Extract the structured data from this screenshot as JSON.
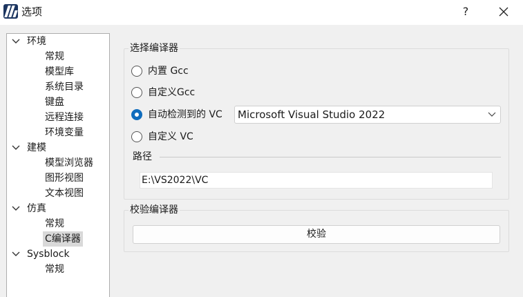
{
  "window": {
    "title": "选项",
    "help_label": "?"
  },
  "tree": {
    "groups": [
      {
        "label": "环境",
        "children": [
          "常规",
          "模型库",
          "系统目录",
          "键盘",
          "远程连接",
          "环境变量"
        ]
      },
      {
        "label": "建模",
        "children": [
          "模型浏览器",
          "图形视图",
          "文本视图"
        ]
      },
      {
        "label": "仿真",
        "children": [
          "常规",
          "C编译器"
        ]
      },
      {
        "label": "Sysblock",
        "children": [
          "常规"
        ]
      }
    ],
    "selected": "C编译器"
  },
  "compiler_group": {
    "title": "选择编译器",
    "options": [
      "内置 Gcc",
      "自定义Gcc",
      "自动检测到的 VC",
      "自定义 VC"
    ],
    "selected_option": "自动检测到的 VC",
    "vc_combo_value": "Microsoft Visual Studio 2022",
    "path_label": "路径",
    "path_value": "E:\\VS2022\\VC"
  },
  "verify_group": {
    "title": "校验编译器",
    "button_label": "校验"
  },
  "colors": {
    "accent": "#0f6cbd",
    "logo": "#1c3560",
    "selection": "#d9d9d9"
  }
}
